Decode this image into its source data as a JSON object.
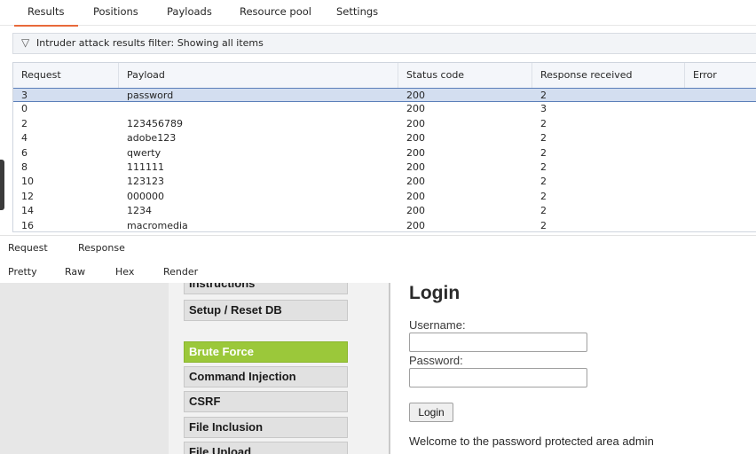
{
  "top_tabs": [
    "Results",
    "Positions",
    "Payloads",
    "Resource pool",
    "Settings"
  ],
  "active_top_tab": "Results",
  "filter": {
    "icon": "filter-icon",
    "text": "Intruder attack results filter: Showing all items"
  },
  "table": {
    "columns": [
      "Request",
      "Payload",
      "Status code",
      "Response received",
      "Error"
    ],
    "selected_request": "3",
    "rows": [
      {
        "request": "3",
        "payload": "password",
        "status": "200",
        "received": "2",
        "error": ""
      },
      {
        "request": "0",
        "payload": "",
        "status": "200",
        "received": "3",
        "error": ""
      },
      {
        "request": "2",
        "payload": "123456789",
        "status": "200",
        "received": "2",
        "error": ""
      },
      {
        "request": "4",
        "payload": "adobe123",
        "status": "200",
        "received": "2",
        "error": ""
      },
      {
        "request": "6",
        "payload": "qwerty",
        "status": "200",
        "received": "2",
        "error": ""
      },
      {
        "request": "8",
        "payload": "111111",
        "status": "200",
        "received": "2",
        "error": ""
      },
      {
        "request": "10",
        "payload": "123123",
        "status": "200",
        "received": "2",
        "error": ""
      },
      {
        "request": "12",
        "payload": "000000",
        "status": "200",
        "received": "2",
        "error": ""
      },
      {
        "request": "14",
        "payload": "1234",
        "status": "200",
        "received": "2",
        "error": ""
      },
      {
        "request": "16",
        "payload": "macromedia",
        "status": "200",
        "received": "2",
        "error": ""
      }
    ]
  },
  "message_tabs": [
    "Request",
    "Response"
  ],
  "active_message_tab": "Response",
  "view_tabs": [
    "Pretty",
    "Raw",
    "Hex",
    "Render"
  ],
  "active_view_tab": "Render",
  "render": {
    "menu_items": [
      {
        "label": "Instructions",
        "active": false
      },
      {
        "label": "Setup / Reset DB",
        "active": false
      },
      {
        "label": "Brute Force",
        "active": true
      },
      {
        "label": "Command Injection",
        "active": false
      },
      {
        "label": "CSRF",
        "active": false
      },
      {
        "label": "File Inclusion",
        "active": false
      },
      {
        "label": "File Upload",
        "active": false
      }
    ],
    "login": {
      "title": "Login",
      "username_label": "Username:",
      "password_label": "Password:",
      "username_value": "",
      "password_value": "",
      "button_label": "Login",
      "message": "Welcome to the password protected area admin"
    }
  },
  "colors": {
    "tab_underline": "#e8693a",
    "selected_row": "#d3def0",
    "active_menu": "#9bc83a"
  }
}
